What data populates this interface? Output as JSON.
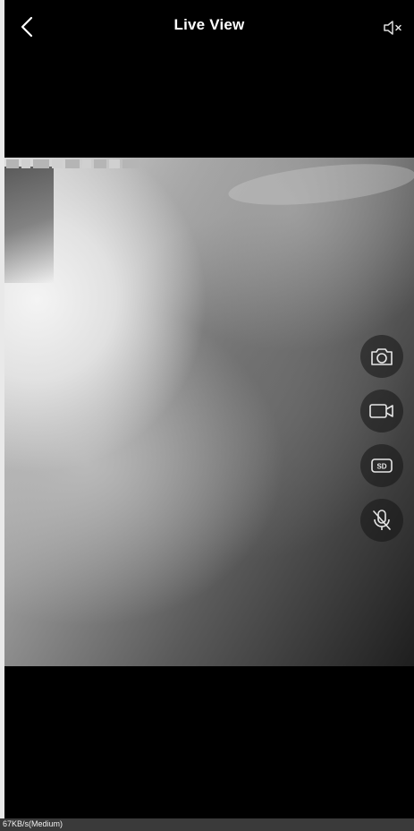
{
  "header": {
    "title": "Live View",
    "back_icon": "chevron-left-icon",
    "speaker_icon": "speaker-mute-icon"
  },
  "video": {
    "controls": [
      {
        "name": "snapshot",
        "icon": "camera-icon"
      },
      {
        "name": "record",
        "icon": "video-camera-icon"
      },
      {
        "name": "quality",
        "icon": "sd-icon",
        "label": "SD"
      },
      {
        "name": "microphone",
        "icon": "mic-off-icon"
      }
    ]
  },
  "status": {
    "bitrate": "67KB/s(Medium)"
  },
  "colors": {
    "background": "#000000",
    "text": "#ffffff",
    "status_bar": "#3a3a3a",
    "control_bg": "#141414"
  }
}
